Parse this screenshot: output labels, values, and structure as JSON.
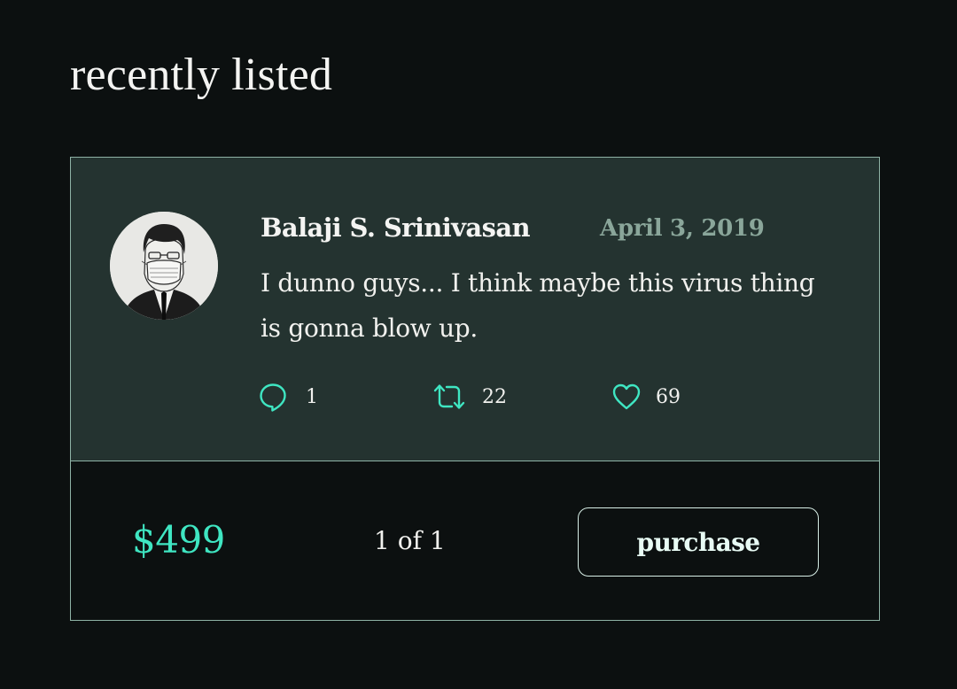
{
  "page": {
    "title": "recently listed"
  },
  "listing": {
    "tweet": {
      "author": "Balaji S. Srinivasan",
      "date": "April 3, 2019",
      "text": "I dunno guys... I think maybe this virus thing is gonna blow up.",
      "stats": {
        "replies": "1",
        "retweets": "22",
        "likes": "69"
      }
    },
    "price": "$499",
    "edition": "1 of 1",
    "purchase_label": "purchase"
  },
  "colors": {
    "background": "#0c1010",
    "card_tweet_bg": "#243330",
    "accent": "#3fe6c2",
    "date_text": "#8aa69a",
    "border": "#8fb3a6"
  },
  "icons": {
    "reply": "reply-icon",
    "retweet": "retweet-icon",
    "like": "heart-icon",
    "avatar": "masked-man-portrait"
  }
}
